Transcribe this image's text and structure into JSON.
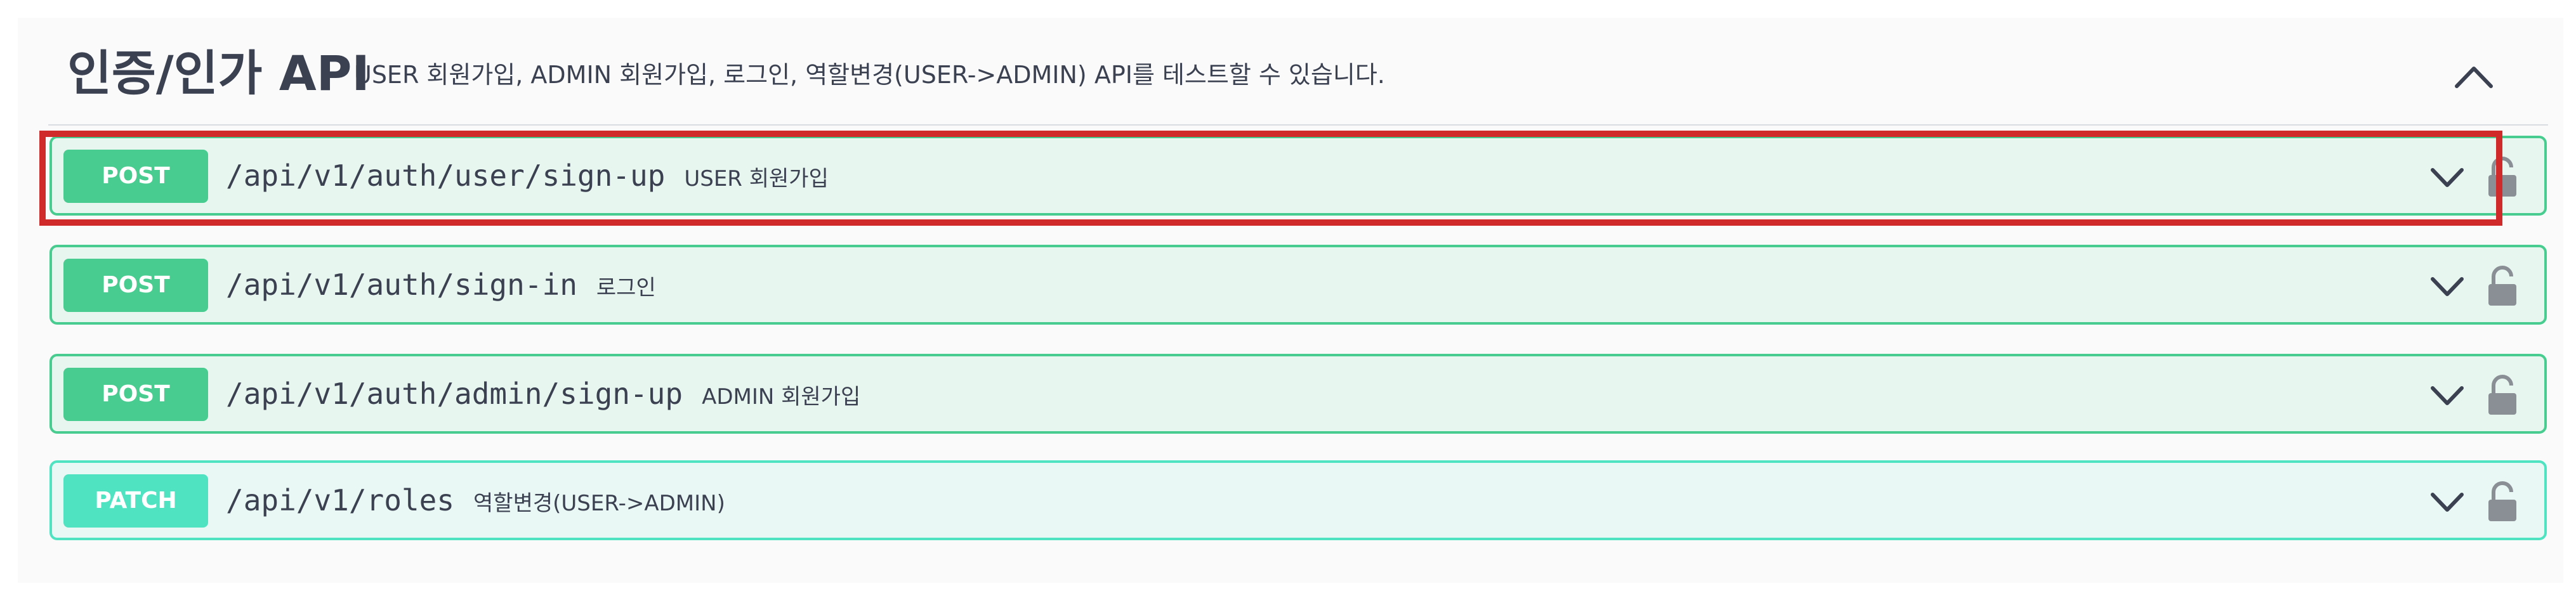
{
  "tag": {
    "title": "인증/인가 API",
    "description": "USER 회원가입, ADMIN 회원가입, 로그인, 역할변경(USER->ADMIN) API를 테스트할 수 있습니다.",
    "collapse_icon": "chevron-up-icon"
  },
  "operations": [
    {
      "method": "POST",
      "path": "/api/v1/auth/user/sign-up",
      "summary": "USER 회원가입",
      "color": "#49cc90",
      "highlighted": true
    },
    {
      "method": "POST",
      "path": "/api/v1/auth/sign-in",
      "summary": "로그인",
      "color": "#49cc90"
    },
    {
      "method": "POST",
      "path": "/api/v1/auth/admin/sign-up",
      "summary": "ADMIN 회원가입",
      "color": "#49cc90"
    },
    {
      "method": "PATCH",
      "path": "/api/v1/roles",
      "summary": "역할변경(USER->ADMIN)",
      "color": "#50e3c2"
    }
  ],
  "icons": {
    "expand": "chevron-down-icon",
    "auth": "lock-icon"
  },
  "colors": {
    "post": "#49cc90",
    "patch": "#50e3c2",
    "highlight": "#d12a2a",
    "text": "#3b4151"
  }
}
